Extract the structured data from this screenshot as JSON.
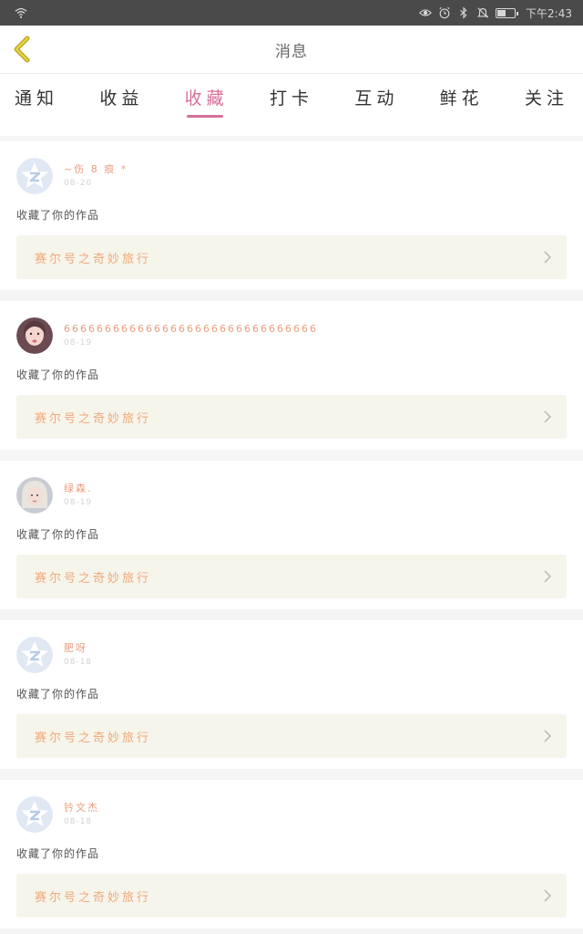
{
  "status_bar": {
    "time": "下午2:43",
    "icons": [
      "wifi-icon",
      "eye-icon",
      "alarm-icon",
      "bluetooth-icon",
      "mute-icon",
      "battery-icon"
    ]
  },
  "header": {
    "title": "消息",
    "back_icon": "chevron-left-icon",
    "accent_color": "#c8b428"
  },
  "tabs": [
    {
      "label": "通知",
      "active": false
    },
    {
      "label": "收益",
      "active": false
    },
    {
      "label": "收藏",
      "active": true
    },
    {
      "label": "打卡",
      "active": false
    },
    {
      "label": "互动",
      "active": false
    },
    {
      "label": "鲜花",
      "active": false
    },
    {
      "label": "关注",
      "active": false
    }
  ],
  "colors": {
    "active_tab": "#d6709a",
    "username": "#e8a080",
    "work_title": "#f0a87a",
    "work_box_bg": "#f6f5ec"
  },
  "items": [
    {
      "name": "~伤 8 痕 *",
      "date": "08-20",
      "avatar": "default-star-avatar",
      "action": "收藏了你的作品",
      "work": "赛尔号之奇妙旅行"
    },
    {
      "name": "6666666666666666666666666666666",
      "date": "08-19",
      "avatar": "user-photo-avatar",
      "action": "收藏了你的作品",
      "work": "赛尔号之奇妙旅行"
    },
    {
      "name": "绿森.",
      "date": "08-19",
      "avatar": "user-photo-avatar",
      "action": "收藏了你的作品",
      "work": "赛尔号之奇妙旅行"
    },
    {
      "name": "肥呀",
      "date": "08-18",
      "avatar": "default-star-avatar",
      "action": "收藏了你的作品",
      "work": "赛尔号之奇妙旅行"
    },
    {
      "name": "钤文杰",
      "date": "08-18",
      "avatar": "default-star-avatar",
      "action": "收藏了你的作品",
      "work": "赛尔号之奇妙旅行"
    }
  ]
}
